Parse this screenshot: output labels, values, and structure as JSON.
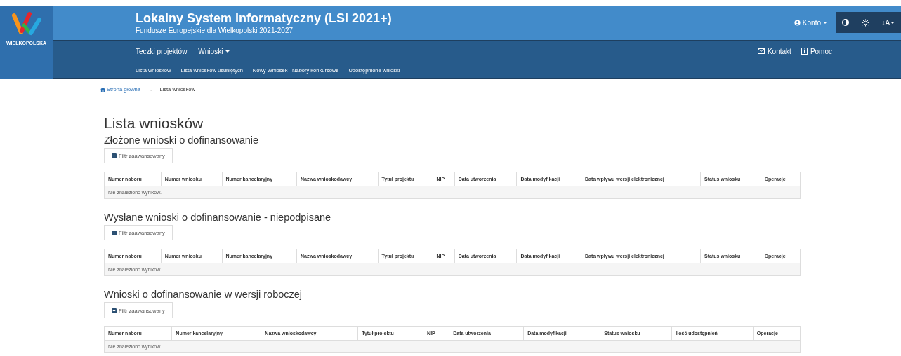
{
  "header": {
    "logo_text": "WIELKOPOLSKA",
    "title": "Lokalny System Informatyczny (LSI 2021+)",
    "subtitle": "Fundusze Europejskie dla Wielkopolski 2021-2027",
    "account": "Konto",
    "font_size_label": "↕A"
  },
  "nav": {
    "main": [
      {
        "label": "Teczki projektów",
        "dropdown": false
      },
      {
        "label": "Wnioski",
        "dropdown": true
      }
    ],
    "right": [
      {
        "label": "Kontakt",
        "kind": "mail"
      },
      {
        "label": "Pomoc",
        "kind": "info"
      }
    ],
    "sub": [
      "Lista wniosków",
      "Lista wniosków usuniętych",
      "Nowy Wniosek - Nabory konkursowe",
      "Udostępnione wnioski"
    ]
  },
  "breadcrumb": {
    "home": "Strona główna",
    "separator": "→",
    "current": "Lista wniosków"
  },
  "page_title": "Lista wniosków",
  "sections": [
    {
      "title": "Złożone wnioski o dofinansowanie",
      "filter": {
        "label": "Filtr zaawansowany",
        "selected": false
      },
      "columns": [
        "Numer naboru",
        "Numer wniosku",
        "Numer kancelaryjny",
        "Nazwa wnioskodawcy",
        "Tytuł projektu",
        "NIP",
        "Data utworzenia",
        "Data modyfikacji",
        "Data wpływu wersji elektronicznej",
        "Status wniosku",
        "Operacje"
      ],
      "empty": "Nie znaleziono wyników."
    },
    {
      "title": "Wysłane wnioski o dofinansowanie - niepodpisane",
      "filter": {
        "label": "Filtr zaawansowany",
        "selected": false
      },
      "columns": [
        "Numer naboru",
        "Numer wniosku",
        "Numer kancelaryjny",
        "Nazwa wnioskodawcy",
        "Tytuł projektu",
        "NIP",
        "Data utworzenia",
        "Data modyfikacji",
        "Data wpływu wersji elektronicznej",
        "Status wniosku",
        "Operacje"
      ],
      "empty": "Nie znaleziono wyników."
    },
    {
      "title": "Wnioski o dofinansowanie w wersji roboczej",
      "filter": {
        "label": "Filtr zaawansowany",
        "selected": true
      },
      "columns": [
        "Numer naboru",
        "Numer kancelaryjny",
        "Nazwa wnioskodawcy",
        "Tytuł projektu",
        "NIP",
        "Data utworzenia",
        "Data modyfikacji",
        "Status wniosku",
        "Ilość udostępnień",
        "Operacje"
      ],
      "empty": "Nie znaleziono wyników."
    }
  ]
}
